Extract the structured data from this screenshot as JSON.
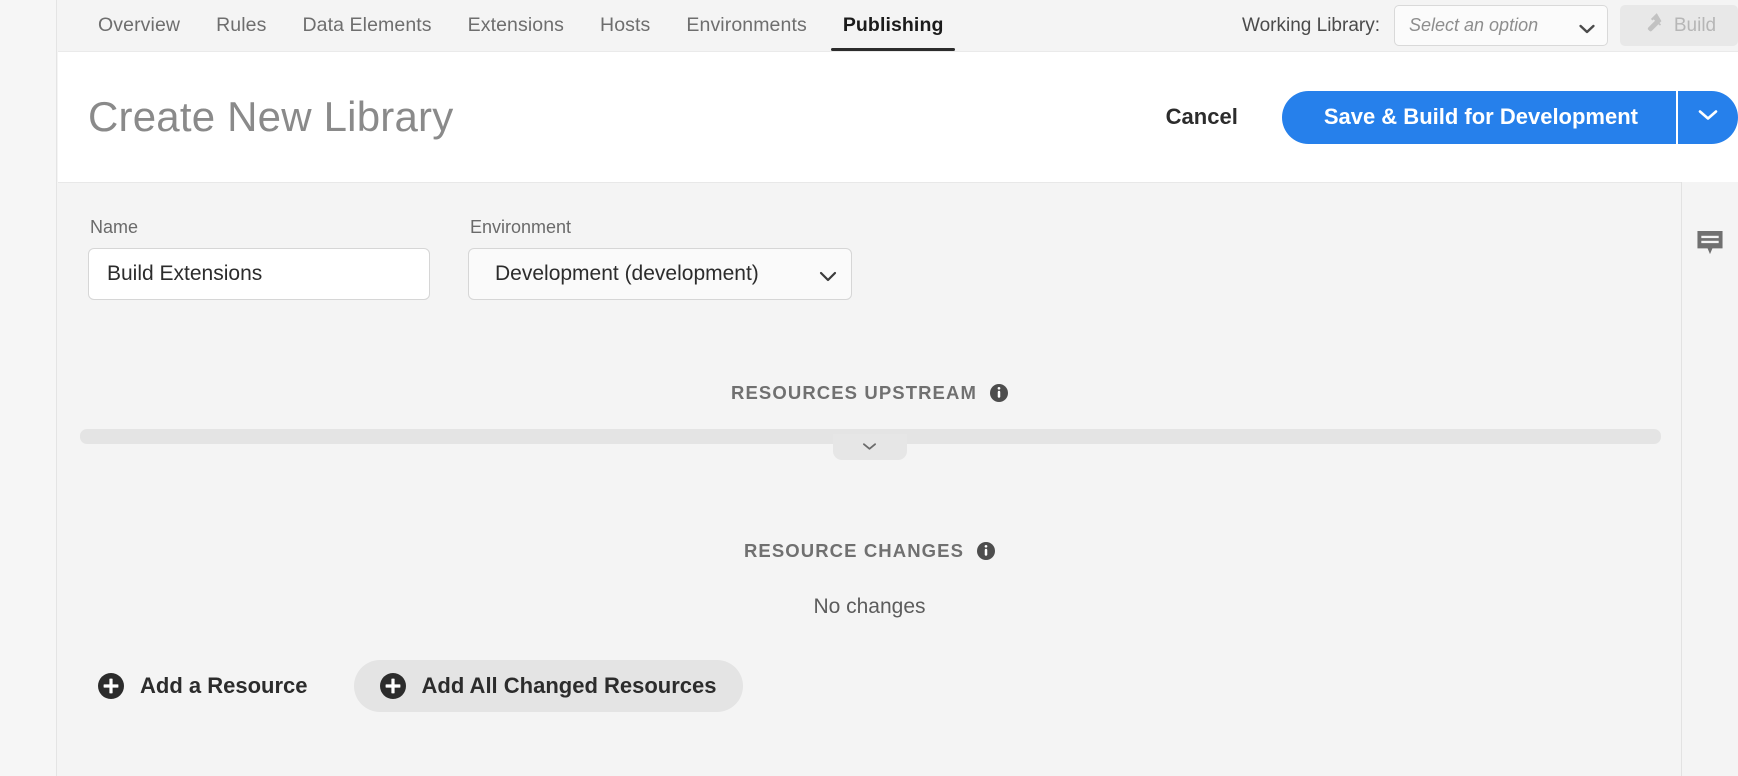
{
  "nav": {
    "tabs": [
      {
        "label": "Overview",
        "active": false
      },
      {
        "label": "Rules",
        "active": false
      },
      {
        "label": "Data Elements",
        "active": false
      },
      {
        "label": "Extensions",
        "active": false
      },
      {
        "label": "Hosts",
        "active": false
      },
      {
        "label": "Environments",
        "active": false
      },
      {
        "label": "Publishing",
        "active": true
      }
    ],
    "working_library_label": "Working Library:",
    "working_library_placeholder": "Select an option",
    "build_button_label": "Build",
    "build_icon": "hammer-icon",
    "build_disabled": true
  },
  "header": {
    "title": "Create New Library",
    "cancel_label": "Cancel",
    "save_label": "Save & Build for Development",
    "save_dropdown_icon": "chevron-down-icon",
    "accent_color": "#2680EB"
  },
  "form": {
    "name": {
      "label": "Name",
      "value": "Build Extensions"
    },
    "environment": {
      "label": "Environment",
      "value": "Development (development)",
      "dropdown_icon": "chevron-down-icon"
    }
  },
  "resources_upstream": {
    "title": "RESOURCES UPSTREAM",
    "info_icon": "info-icon",
    "expander_icon": "chevron-down-icon"
  },
  "resource_changes": {
    "title": "RESOURCE CHANGES",
    "info_icon": "info-icon",
    "empty_text": "No changes"
  },
  "actions": {
    "add_resource": {
      "label": "Add a Resource",
      "icon": "plus-circle-icon",
      "hovered": false
    },
    "add_all_changed": {
      "label": "Add All Changed Resources",
      "icon": "plus-circle-icon",
      "hovered": true
    }
  },
  "right_panel": {
    "comment_icon": "comment-icon"
  }
}
